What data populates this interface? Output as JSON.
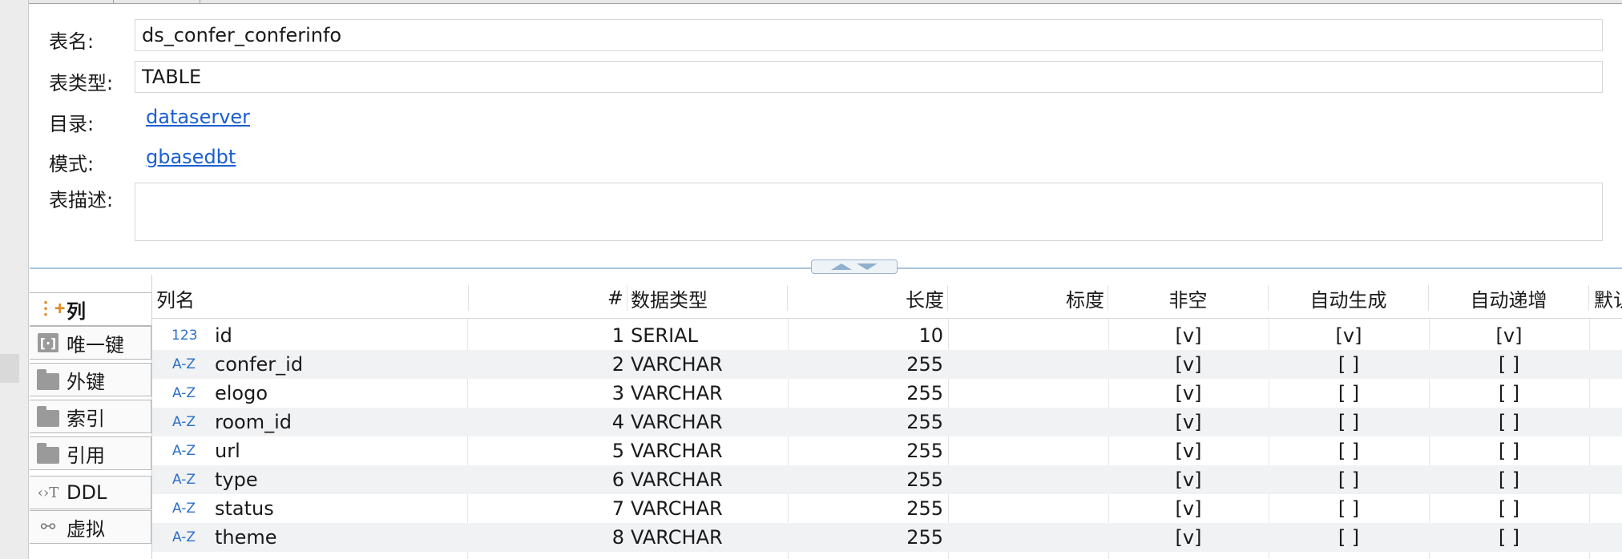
{
  "properties": {
    "table_name_label": "表名:",
    "table_name_value": "ds_confer_conferinfo",
    "table_type_label": "表类型:",
    "table_type_value": "TABLE",
    "catalog_label": "目录:",
    "catalog_link": "dataserver",
    "schema_label": "模式:",
    "schema_link": "gbasedbt",
    "description_label": "表描述:",
    "description_value": ""
  },
  "side_tabs": [
    {
      "label": "列",
      "icon": "columns-icon",
      "active": true
    },
    {
      "label": "唯一键",
      "icon": "unique-key-icon",
      "active": false
    },
    {
      "label": "外键",
      "icon": "folder-icon",
      "active": false
    },
    {
      "label": "索引",
      "icon": "folder-icon",
      "active": false
    },
    {
      "label": "引用",
      "icon": "folder-icon",
      "active": false
    },
    {
      "label": "DDL",
      "icon": "ddl-icon",
      "active": false
    },
    {
      "label": "虚拟",
      "icon": "virtual-icon",
      "active": false
    }
  ],
  "grid": {
    "headers": [
      "列名",
      "#",
      "数据类型",
      "长度",
      "标度",
      "非空",
      "自动生成",
      "自动递增",
      "默认"
    ],
    "rows": [
      {
        "icon": "123",
        "name": "id",
        "num": "1",
        "type": "SERIAL",
        "length": "10",
        "scale": "",
        "not_null": "[v]",
        "auto_gen": "[v]",
        "auto_inc": "[v]"
      },
      {
        "icon": "A-Z",
        "name": "confer_id",
        "num": "2",
        "type": "VARCHAR",
        "length": "255",
        "scale": "",
        "not_null": "[v]",
        "auto_gen": "[ ]",
        "auto_inc": "[ ]"
      },
      {
        "icon": "A-Z",
        "name": "elogo",
        "num": "3",
        "type": "VARCHAR",
        "length": "255",
        "scale": "",
        "not_null": "[v]",
        "auto_gen": "[ ]",
        "auto_inc": "[ ]"
      },
      {
        "icon": "A-Z",
        "name": "room_id",
        "num": "4",
        "type": "VARCHAR",
        "length": "255",
        "scale": "",
        "not_null": "[v]",
        "auto_gen": "[ ]",
        "auto_inc": "[ ]"
      },
      {
        "icon": "A-Z",
        "name": "url",
        "num": "5",
        "type": "VARCHAR",
        "length": "255",
        "scale": "",
        "not_null": "[v]",
        "auto_gen": "[ ]",
        "auto_inc": "[ ]"
      },
      {
        "icon": "A-Z",
        "name": "type",
        "num": "6",
        "type": "VARCHAR",
        "length": "255",
        "scale": "",
        "not_null": "[v]",
        "auto_gen": "[ ]",
        "auto_inc": "[ ]"
      },
      {
        "icon": "A-Z",
        "name": "status",
        "num": "7",
        "type": "VARCHAR",
        "length": "255",
        "scale": "",
        "not_null": "[v]",
        "auto_gen": "[ ]",
        "auto_inc": "[ ]"
      },
      {
        "icon": "A-Z",
        "name": "theme",
        "num": "8",
        "type": "VARCHAR",
        "length": "255",
        "scale": "",
        "not_null": "[v]",
        "auto_gen": "[ ]",
        "auto_inc": "[ ]"
      }
    ]
  },
  "colors": {
    "link": "#1a5fd0",
    "type_icon": "#2b6fc7",
    "columns_icon": "#e08a1e",
    "row_alt": "#f1f2f4",
    "splitter": "#a9c4dc"
  }
}
